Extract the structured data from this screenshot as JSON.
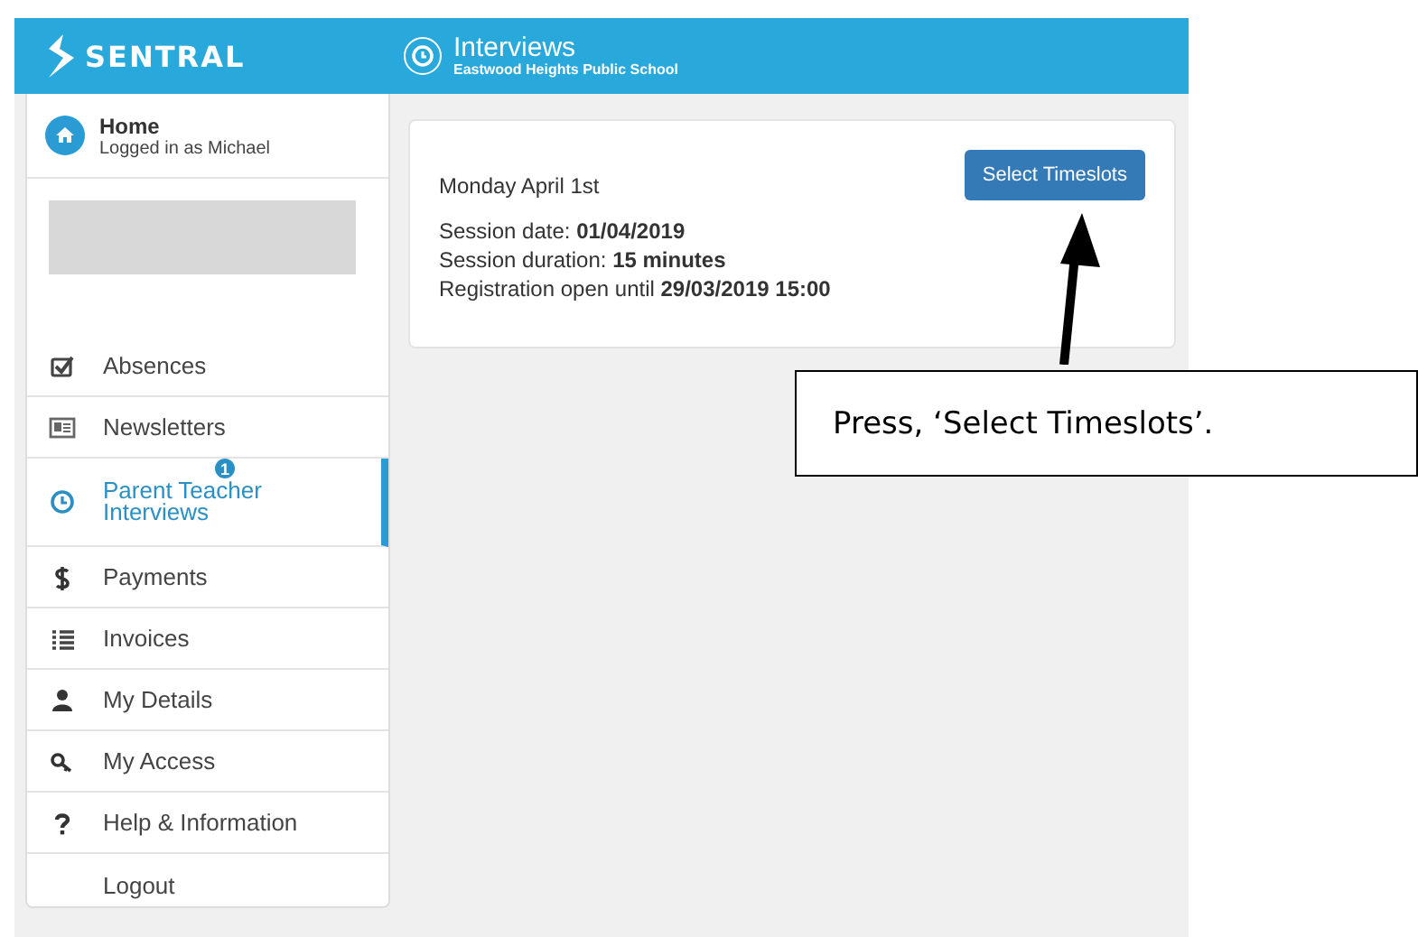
{
  "header": {
    "brand": "SENTRAL",
    "title": "Interviews",
    "subtitle": "Eastwood Heights Public School"
  },
  "home": {
    "title": "Home",
    "subtitle": "Logged in as Michael"
  },
  "sidebar": {
    "items": [
      {
        "label": "Absences",
        "selected": false
      },
      {
        "label": "Newsletters",
        "selected": false
      },
      {
        "label": "Parent Teacher Interviews",
        "selected": true,
        "badge": "1"
      },
      {
        "label": "Payments",
        "selected": false
      },
      {
        "label": "Invoices",
        "selected": false
      },
      {
        "label": "My Details",
        "selected": false
      },
      {
        "label": "My Access",
        "selected": false
      },
      {
        "label": "Help & Information",
        "selected": false
      },
      {
        "label": "Logout",
        "selected": false
      }
    ]
  },
  "session": {
    "heading": "Monday April 1st",
    "button": "Select Timeslots",
    "lines": [
      "Session date: **01/04/2019**",
      "Session duration: **15 minutes**",
      "Registration open until **29/03/2019 15:00**"
    ]
  },
  "callout": {
    "text": "Press, ‘Select Timeslots’."
  }
}
